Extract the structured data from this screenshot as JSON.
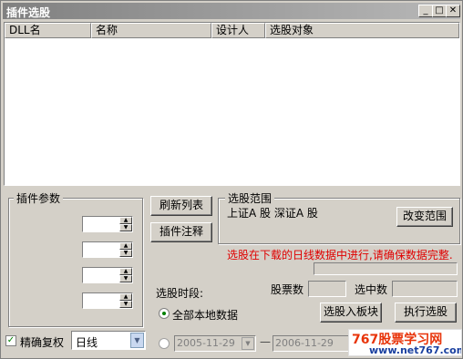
{
  "window": {
    "title": "插件选股",
    "minimize_glyph": "_",
    "maximize_glyph": "□",
    "close_glyph": "✕"
  },
  "list": {
    "columns": [
      "DLL名",
      "名称",
      "设计人",
      "选股对象"
    ],
    "rows": []
  },
  "params": {
    "group_label": "插件参数",
    "spinners": [
      "",
      "",
      "",
      ""
    ]
  },
  "buttons": {
    "refresh": "刷新列表",
    "notes": "插件注释",
    "change_range": "改变范围",
    "to_block": "选股入板块",
    "run": "执行选股"
  },
  "range": {
    "group_label": "选股范围",
    "value": "上证A 股  深证A 股"
  },
  "warning": "选股在下载的日线数据中进行,请确保数据完整.",
  "period": {
    "label": "选股时段:",
    "all_local": "全部本地数据",
    "start_date": "2005-11-29",
    "end_date": "2006-11-29",
    "dash": "—"
  },
  "stats": {
    "stock_count_label": "股票数",
    "selected_label": "选中数",
    "stock_count_value": "",
    "selected_value": ""
  },
  "options": {
    "exact_rights_label": "精确复权",
    "exact_rights_checked": true,
    "period_select": "日线"
  },
  "watermark": {
    "main": "767股票学习网",
    "sub": "www.net767.com"
  },
  "colors": {
    "warning": "#e00000",
    "radio_dot": "#008000"
  }
}
